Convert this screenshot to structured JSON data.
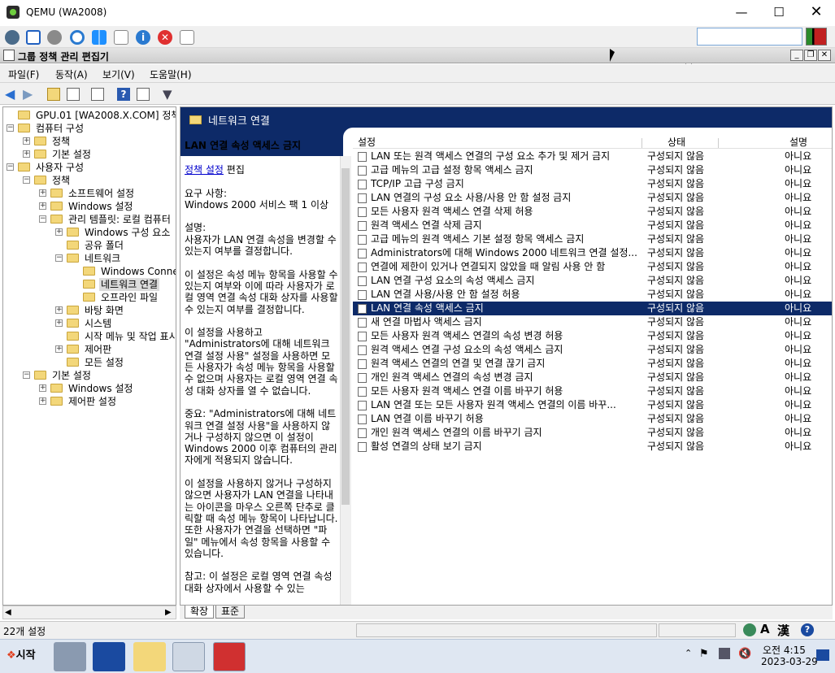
{
  "qemu": {
    "title": "QEMU (WA2008)",
    "search_value": ""
  },
  "window": {
    "title": "그룹 정책 관리 편집기"
  },
  "menu": [
    "파일(F)",
    "동작(A)",
    "보기(V)",
    "도움말(H)"
  ],
  "tree": [
    {
      "label": "GPU.01 [WA2008.X.COM] 정책",
      "depth": 0,
      "exp": "",
      "sel": false
    },
    {
      "label": "컴퓨터 구성",
      "depth": 0,
      "exp": "−",
      "sel": false
    },
    {
      "label": "정책",
      "depth": 1,
      "exp": "+",
      "sel": false
    },
    {
      "label": "기본 설정",
      "depth": 1,
      "exp": "+",
      "sel": false
    },
    {
      "label": "사용자 구성",
      "depth": 0,
      "exp": "−",
      "sel": false
    },
    {
      "label": "정책",
      "depth": 1,
      "exp": "−",
      "sel": false
    },
    {
      "label": "소프트웨어 설정",
      "depth": 2,
      "exp": "+",
      "sel": false
    },
    {
      "label": "Windows 설정",
      "depth": 2,
      "exp": "+",
      "sel": false
    },
    {
      "label": "관리 템플릿: 로컬 컴퓨터",
      "depth": 2,
      "exp": "−",
      "sel": false
    },
    {
      "label": "Windows 구성 요소",
      "depth": 3,
      "exp": "+",
      "sel": false
    },
    {
      "label": "공유 폴더",
      "depth": 3,
      "exp": "",
      "sel": false
    },
    {
      "label": "네트워크",
      "depth": 3,
      "exp": "−",
      "sel": false
    },
    {
      "label": "Windows Connect",
      "depth": 4,
      "exp": "",
      "sel": false
    },
    {
      "label": "네트워크 연결",
      "depth": 4,
      "exp": "",
      "sel": true
    },
    {
      "label": "오프라인 파일",
      "depth": 4,
      "exp": "",
      "sel": false
    },
    {
      "label": "바탕 화면",
      "depth": 3,
      "exp": "+",
      "sel": false
    },
    {
      "label": "시스템",
      "depth": 3,
      "exp": "+",
      "sel": false
    },
    {
      "label": "시작 메뉴 및 작업 표시줄",
      "depth": 3,
      "exp": "",
      "sel": false
    },
    {
      "label": "제어판",
      "depth": 3,
      "exp": "+",
      "sel": false
    },
    {
      "label": "모든 설정",
      "depth": 3,
      "exp": "",
      "sel": false
    },
    {
      "label": "기본 설정",
      "depth": 1,
      "exp": "−",
      "sel": false
    },
    {
      "label": "Windows 설정",
      "depth": 2,
      "exp": "+",
      "sel": false
    },
    {
      "label": "제어판 설정",
      "depth": 2,
      "exp": "+",
      "sel": false
    }
  ],
  "right": {
    "header": "네트워크 연결",
    "desc_title": "LAN 연결 속성 액세스 금지",
    "desc_link": "정책 설정",
    "desc_link_suffix": " 편집",
    "desc_body": "요구 사항:\nWindows 2000 서비스 팩 1 이상\n\n설명:\n사용자가 LAN 연결 속성을 변경할 수 있는지 여부를 결정합니다.\n\n이 설정은 속성 메뉴 항목을 사용할 수 있는지 여부와 이에 따라 사용자가 로컬 영역 연결 속성 대화 상자를 사용할 수 있는지 여부를 결정합니다.\n\n이 설정을 사용하고 \"Administrators에 대해 네트워크 연결 설정 사용\" 설정을 사용하면 모든 사용자가 속성 메뉴 항목을 사용할 수 없으며 사용자는 로컬 영역 연결 속성 대화 상자를 열 수 없습니다.\n\n중요: \"Administrators에 대해 네트워크 연결 설정 사용\"을 사용하지 않거나 구성하지 않으면 이 설정이 Windows 2000 이후 컴퓨터의 관리자에게 적용되지 않습니다.\n\n이 설정을 사용하지 않거나 구성하지 않으면 사용자가 LAN 연결을 나타내는 아이콘을 마우스 오른쪽 단추로 클릭할 때 속성 메뉴 항목이 나타납니다. 또한 사용자가 연결을 선택하면 \"파일\" 메뉴에서 속성 항목을 사용할 수 있습니다.\n\n참고: 이 설정은 로컬 영역 연결 속성 대화 상자에서 사용할 수 있는",
    "cols": [
      "설정",
      "상태",
      "설명"
    ],
    "rows": [
      {
        "name": "LAN 또는 원격 액세스 연결의 구성 요소 추가 및 제거 금지",
        "state": "구성되지 않음",
        "comment": "아니요"
      },
      {
        "name": "고급 메뉴의 고급 설정 항목 액세스 금지",
        "state": "구성되지 않음",
        "comment": "아니요"
      },
      {
        "name": "TCP/IP 고급 구성 금지",
        "state": "구성되지 않음",
        "comment": "아니요"
      },
      {
        "name": "LAN 연결의 구성 요소 사용/사용 안 함 설정 금지",
        "state": "구성되지 않음",
        "comment": "아니요"
      },
      {
        "name": "모든 사용자 원격 액세스 연결 삭제 허용",
        "state": "구성되지 않음",
        "comment": "아니요"
      },
      {
        "name": "원격 액세스 연결 삭제 금지",
        "state": "구성되지 않음",
        "comment": "아니요"
      },
      {
        "name": "고급 메뉴의 원격 액세스 기본 설정 항목 액세스 금지",
        "state": "구성되지 않음",
        "comment": "아니요"
      },
      {
        "name": "Administrators에 대해 Windows 2000 네트워크 연결 설정...",
        "state": "구성되지 않음",
        "comment": "아니요"
      },
      {
        "name": "연결에 제한이 있거나 연결되지 않았을 때 알림 사용 안 함",
        "state": "구성되지 않음",
        "comment": "아니요"
      },
      {
        "name": "LAN 연결 구성 요소의 속성 액세스 금지",
        "state": "구성되지 않음",
        "comment": "아니요"
      },
      {
        "name": "LAN 연결 사용/사용 안 함 설정 허용",
        "state": "구성되지 않음",
        "comment": "아니요"
      },
      {
        "name": "LAN 연결 속성 액세스 금지",
        "state": "구성되지 않음",
        "comment": "아니요",
        "sel": true
      },
      {
        "name": "새 연결 마법사 액세스 금지",
        "state": "구성되지 않음",
        "comment": "아니요"
      },
      {
        "name": "모든 사용자 원격 액세스 연결의 속성 변경 허용",
        "state": "구성되지 않음",
        "comment": "아니요"
      },
      {
        "name": "원격 액세스 연결 구성 요소의 속성 액세스 금지",
        "state": "구성되지 않음",
        "comment": "아니요"
      },
      {
        "name": "원격 액세스 연결의 연결 및 연결 끊기 금지",
        "state": "구성되지 않음",
        "comment": "아니요"
      },
      {
        "name": "개인 원격 액세스 연결의 속성 변경 금지",
        "state": "구성되지 않음",
        "comment": "아니요"
      },
      {
        "name": "모든 사용자 원격 액세스 연결 이름 바꾸기 허용",
        "state": "구성되지 않음",
        "comment": "아니요"
      },
      {
        "name": "LAN 연결 또는 모든 사용자 원격 액세스 연결의 이름 바꾸...",
        "state": "구성되지 않음",
        "comment": "아니요"
      },
      {
        "name": "LAN 연결 이름 바꾸기 허용",
        "state": "구성되지 않음",
        "comment": "아니요"
      },
      {
        "name": "개인 원격 액세스 연결의 이름 바꾸기 금지",
        "state": "구성되지 않음",
        "comment": "아니요"
      },
      {
        "name": "활성 연결의 상태 보기 금지",
        "state": "구성되지 않음",
        "comment": "아니요"
      }
    ],
    "tabs": [
      "확장",
      "표준"
    ]
  },
  "status": {
    "text": "22개 설정"
  },
  "taskbar": {
    "start": "시작",
    "clock_time": "오전 4:15",
    "clock_date": "2023-03-29"
  }
}
